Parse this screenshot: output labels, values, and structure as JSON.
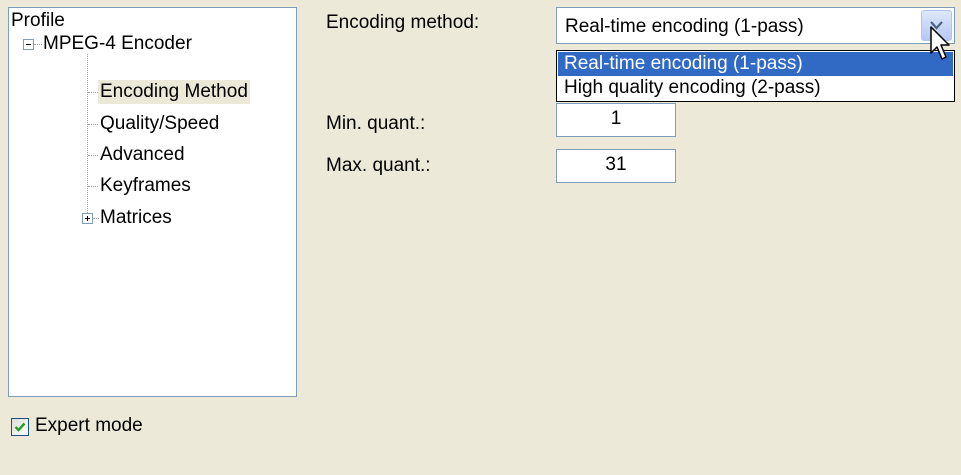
{
  "tree": {
    "header": "Profile",
    "root": {
      "label": "MPEG-4 Encoder",
      "expander": "minus",
      "children": [
        {
          "label": "Encoding Method",
          "selected": true
        },
        {
          "label": "Quality/Speed"
        },
        {
          "label": "Advanced"
        },
        {
          "label": "Keyframes"
        },
        {
          "label": "Matrices",
          "expander": "plus"
        }
      ]
    }
  },
  "form": {
    "encoding_method_label": "Encoding method:",
    "encoding_method_value": "Real-time encoding (1-pass)",
    "encoding_options": [
      "Real-time encoding (1-pass)",
      "High quality encoding (2-pass)"
    ],
    "min_quant_label": "Min. quant.:",
    "min_quant_value": "1",
    "max_quant_label": "Max. quant.:",
    "max_quant_value": "31"
  },
  "expert_mode": {
    "label": "Expert mode",
    "checked": true
  },
  "colors": {
    "window_bg": "#ece9d8",
    "highlight": "#316ac5",
    "border": "#7f9db9",
    "check_green": "#21a121"
  }
}
